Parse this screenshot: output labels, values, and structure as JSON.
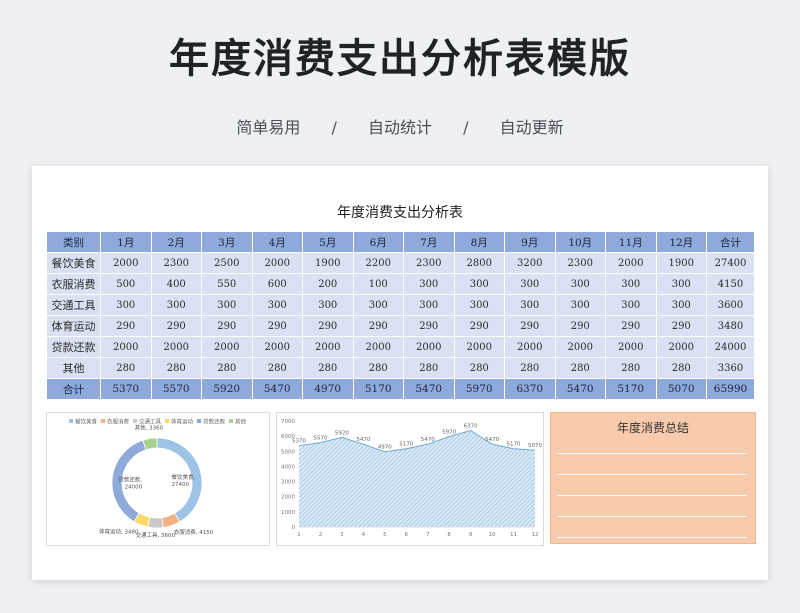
{
  "header": {
    "title": "年度消费支出分析表模版",
    "tags": [
      "简单易用",
      "自动统计",
      "自动更新"
    ],
    "separator": "/"
  },
  "sheet": {
    "title": "年度消费支出分析表",
    "columns": [
      "类别",
      "1月",
      "2月",
      "3月",
      "4月",
      "5月",
      "6月",
      "7月",
      "8月",
      "9月",
      "10月",
      "11月",
      "12月",
      "合计"
    ],
    "rows": [
      {
        "cat": "餐饮美食",
        "vals": [
          "2000",
          "2300",
          "2500",
          "2000",
          "1900",
          "2200",
          "2300",
          "2800",
          "3200",
          "2300",
          "2000",
          "1900",
          "27400"
        ]
      },
      {
        "cat": "衣服消费",
        "vals": [
          "500",
          "400",
          "550",
          "600",
          "200",
          "100",
          "300",
          "300",
          "300",
          "300",
          "300",
          "300",
          "4150"
        ]
      },
      {
        "cat": "交通工具",
        "vals": [
          "300",
          "300",
          "300",
          "300",
          "300",
          "300",
          "300",
          "300",
          "300",
          "300",
          "300",
          "300",
          "3600"
        ]
      },
      {
        "cat": "体育运动",
        "vals": [
          "290",
          "290",
          "290",
          "290",
          "290",
          "290",
          "290",
          "290",
          "290",
          "290",
          "290",
          "290",
          "3480"
        ]
      },
      {
        "cat": "贷款还款",
        "vals": [
          "2000",
          "2000",
          "2000",
          "2000",
          "2000",
          "2000",
          "2000",
          "2000",
          "2000",
          "2000",
          "2000",
          "2000",
          "24000"
        ]
      },
      {
        "cat": "其他",
        "vals": [
          "280",
          "280",
          "280",
          "280",
          "280",
          "280",
          "280",
          "280",
          "280",
          "280",
          "280",
          "280",
          "3360"
        ]
      }
    ],
    "total": {
      "cat": "合计",
      "vals": [
        "5370",
        "5570",
        "5920",
        "5470",
        "4970",
        "5170",
        "5470",
        "5970",
        "6370",
        "5470",
        "5170",
        "5070",
        "65990"
      ]
    }
  },
  "chart_data": [
    {
      "type": "pie",
      "donut": true,
      "labels": [
        "餐饮美食",
        "衣服消费",
        "交通工具",
        "体育运动",
        "贷款还款",
        "其他"
      ],
      "values": [
        27400,
        4150,
        3600,
        3480,
        24000,
        3360
      ],
      "colors": [
        "#9dc3e6",
        "#f4b183",
        "#c9c9c9",
        "#ffd966",
        "#8eaadb",
        "#a9d18e"
      ],
      "legend": "top",
      "data_labels": [
        "餐饮美食, 27400",
        "衣服消费, 4150",
        "交通工具, 3600",
        "体育运动, 3480",
        "贷款还款, 24000",
        "其他, 3360"
      ]
    },
    {
      "type": "area",
      "x": [
        1,
        2,
        3,
        4,
        5,
        6,
        7,
        8,
        9,
        10,
        11,
        12
      ],
      "values": [
        5370,
        5570,
        5920,
        5470,
        4970,
        5170,
        5470,
        5970,
        6370,
        5470,
        5170,
        5070
      ],
      "ylim": [
        0,
        7000
      ],
      "yticks": [
        0,
        1000,
        2000,
        3000,
        4000,
        5000,
        6000,
        7000
      ],
      "color": "#9dc3e6",
      "grid": false
    }
  ],
  "summary": {
    "title": "年度消费总结"
  }
}
